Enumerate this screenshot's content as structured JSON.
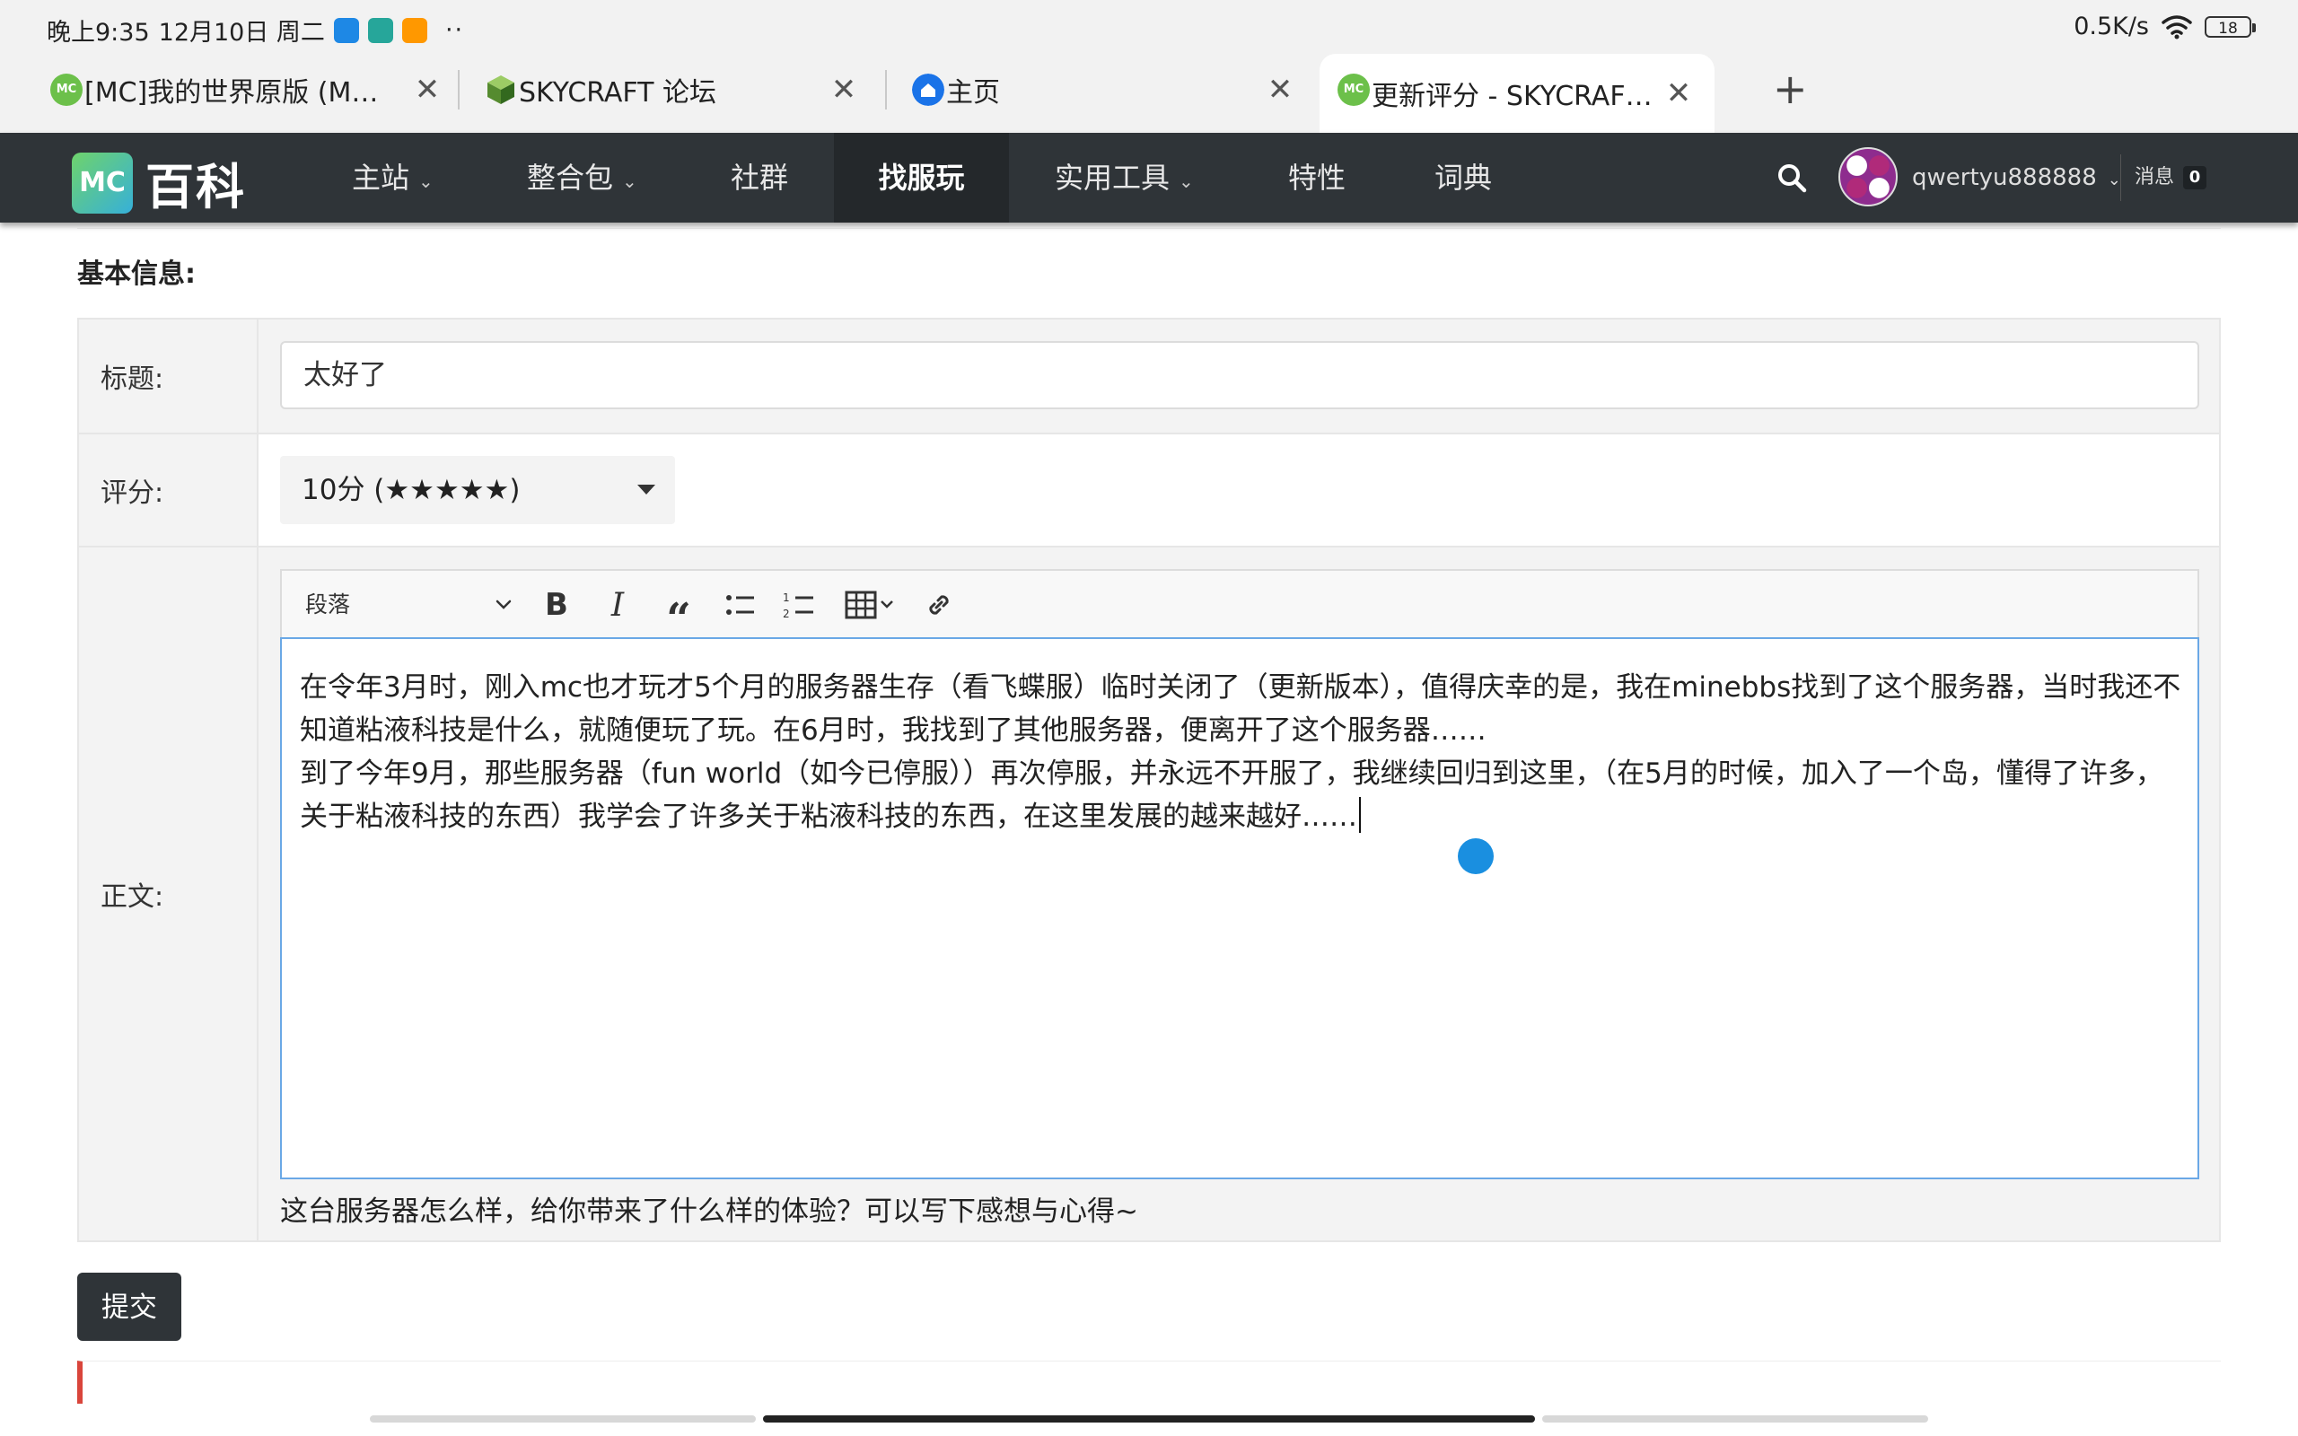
{
  "status_bar": {
    "time": "晚上9:35",
    "date": "12月10日 周二",
    "dots": "··",
    "network_speed": "0.5K/s",
    "battery": "18",
    "app_icon_colors": [
      "#1e88e5",
      "#26a69a",
      "#ff9800"
    ]
  },
  "browser": {
    "tabs": [
      {
        "title": "[MC]我的世界原版 (M…",
        "icon": "mc-wiki-icon",
        "active": false
      },
      {
        "title": "SKYCRAFT 论坛",
        "icon": "skycraft-cube-icon",
        "active": false
      },
      {
        "title": "主页",
        "icon": "home-icon",
        "active": false
      },
      {
        "title": "更新评分 - SKYCRAF…",
        "icon": "mc-wiki-icon",
        "active": true
      }
    ],
    "close_glyph": "✕",
    "new_tab_glyph": "+"
  },
  "navbar": {
    "logo_mark": "MC",
    "logo_text": "百科",
    "items": [
      {
        "label": "主站",
        "has_dropdown": true,
        "active": false
      },
      {
        "label": "整合包",
        "has_dropdown": true,
        "active": false
      },
      {
        "label": "社群",
        "has_dropdown": false,
        "active": false
      },
      {
        "label": "找服玩",
        "has_dropdown": false,
        "active": true
      },
      {
        "label": "实用工具",
        "has_dropdown": true,
        "active": false
      },
      {
        "label": "特性",
        "has_dropdown": false,
        "active": false
      },
      {
        "label": "词典",
        "has_dropdown": false,
        "active": false
      }
    ],
    "username": "qwertyu888888",
    "messages_label": "消息",
    "messages_count": "0",
    "accent_color": "#2f3438"
  },
  "form": {
    "section_title": "基本信息:",
    "title_label": "标题:",
    "title_value": "太好了",
    "rating_label": "评分:",
    "rating_value": "10分 (★★★★★)",
    "body_label": "正文:",
    "toolbar": {
      "paragraph_label": "段落",
      "buttons": [
        "bold-icon",
        "italic-icon",
        "blockquote-icon",
        "bulleted-list-icon",
        "numbered-list-icon",
        "table-icon",
        "link-icon"
      ]
    },
    "body_paragraphs": [
      "在令年3月时，刚入mc也才玩才5个月的服务器生存（看飞蝶服）临时关闭了（更新版本），值得庆幸的是，我在minebbs找到了这个服务器，当时我还不知道粘液科技是什么，就随便玩了玩。在6月时，我找到了其他服务器，便离开了这个服务器……",
      "到了今年9月，那些服务器（fun world（如今已停服））再次停服，并永远不开服了，我继续回归到这里，（在5月的时候，加入了一个岛，懂得了许多，关于粘液科技的东西）我学会了许多关于粘液科技的东西，在这里发展的越来越好……"
    ],
    "body_hint": "这台服务器怎么样，给你带来了什么样的体验？可以写下感想与心得~",
    "submit_label": "提交"
  }
}
